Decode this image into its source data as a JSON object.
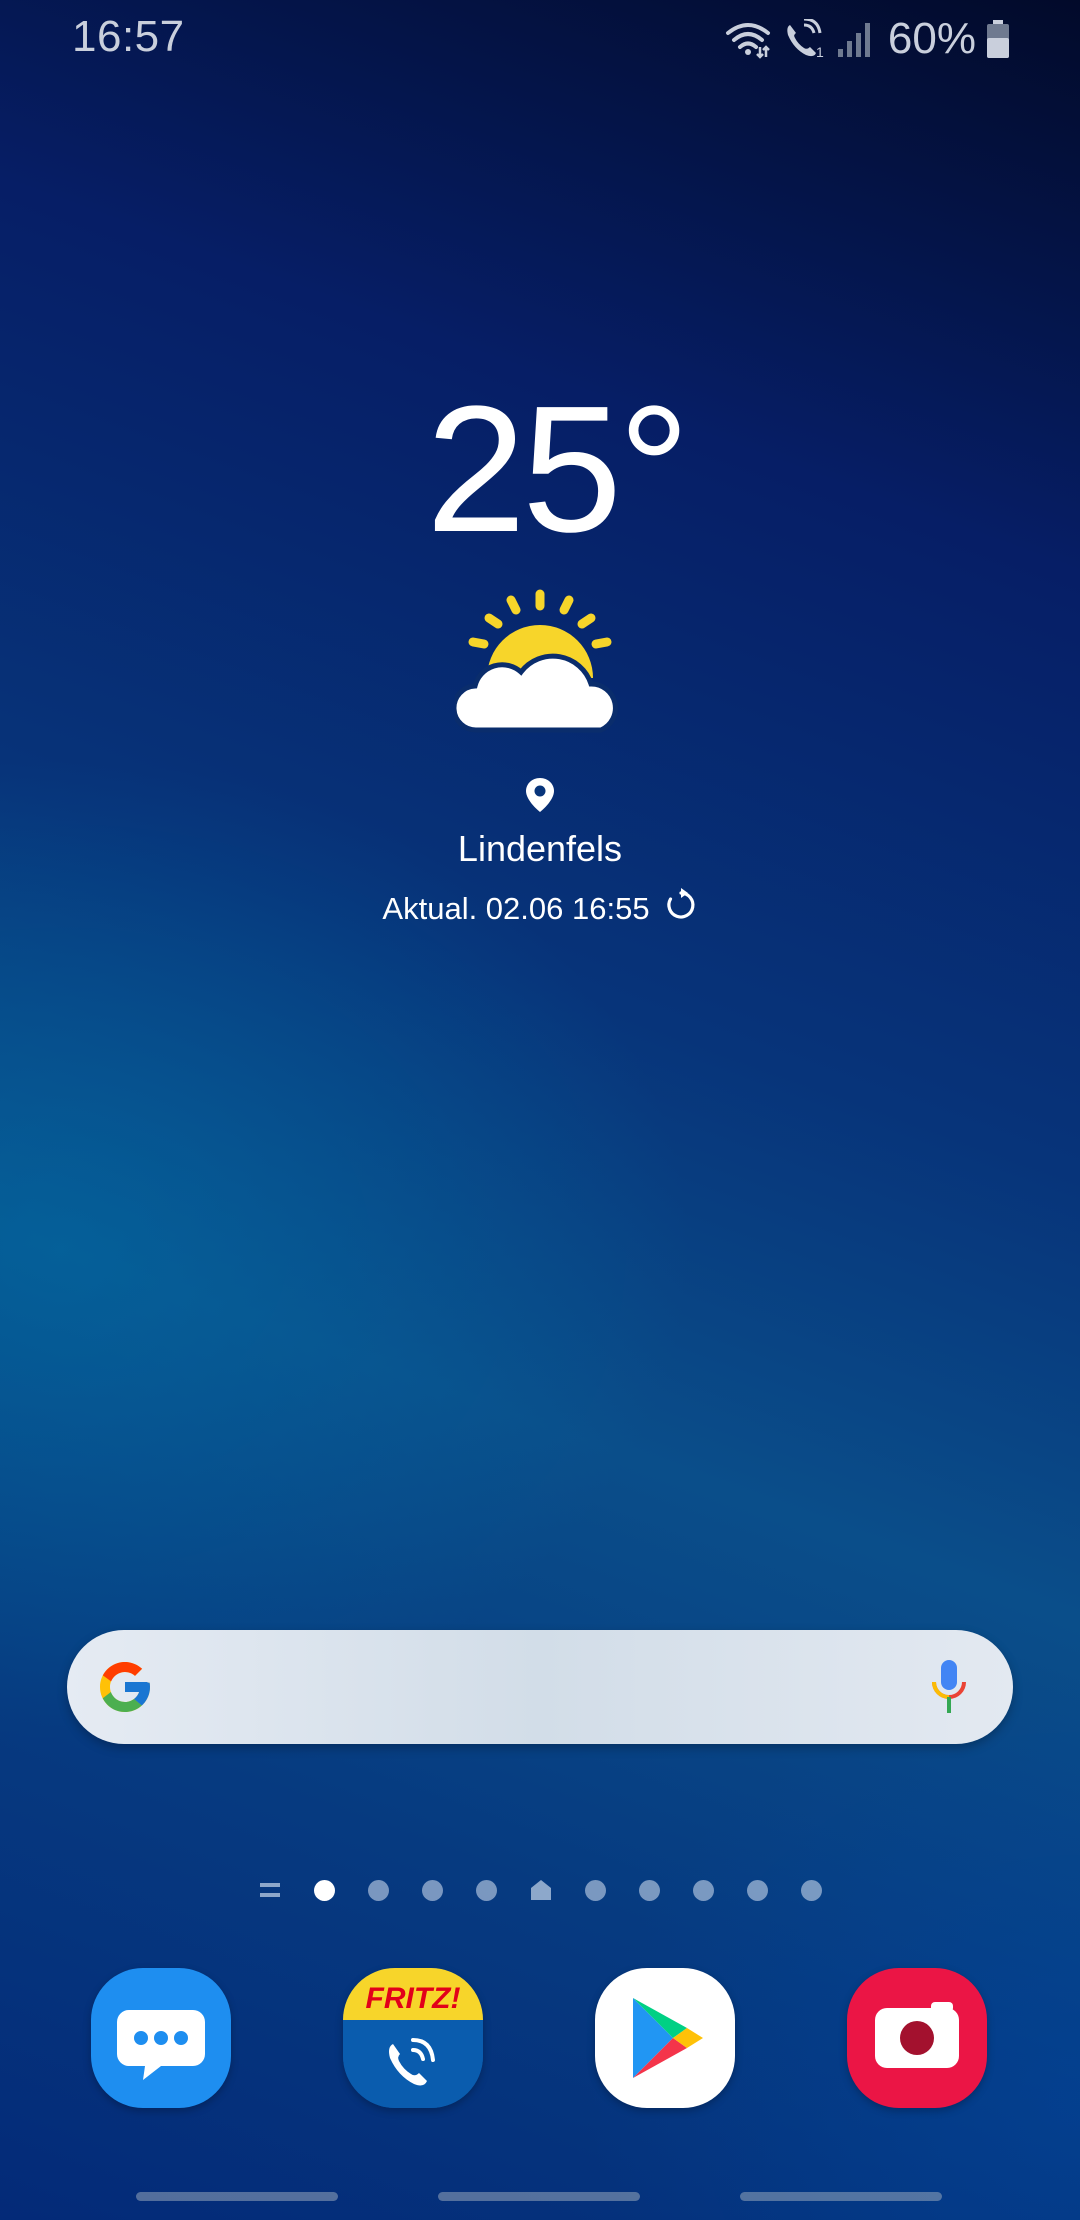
{
  "status_bar": {
    "time": "16:57",
    "battery_percent": "60%",
    "icons": [
      "wifi-icon",
      "wifi-call-icon",
      "signal-icon",
      "battery-icon"
    ]
  },
  "weather": {
    "temperature": "25°",
    "condition_icon": "partly-sunny-icon",
    "location": "Lindenfels",
    "updated": "Aktual. 02.06 16:55"
  },
  "search": {
    "placeholder": "",
    "logo": "google-logo",
    "mic": "mic-icon"
  },
  "page_indicator": {
    "pages": 10,
    "current": 1
  },
  "dock": {
    "apps": [
      {
        "name": "Messages",
        "icon": "messages-icon"
      },
      {
        "name": "FRITZ!App Fon",
        "icon": "fritz-icon",
        "text": "FRITZ!"
      },
      {
        "name": "Play Store",
        "icon": "play-store-icon"
      },
      {
        "name": "Screen Recorder",
        "icon": "camera-icon"
      }
    ]
  },
  "colors": {
    "accent_yellow": "#f7d52a",
    "fritz_red": "#e2001a",
    "camera_red": "#eb1545",
    "messages_blue": "#1e8ef0"
  }
}
